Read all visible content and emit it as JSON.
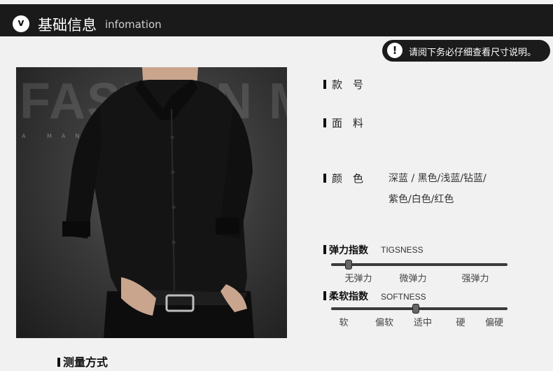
{
  "header": {
    "title": "基础信息",
    "subtitle": "infomation",
    "badge": "v"
  },
  "notice": {
    "icon": "exclamation-icon",
    "text": "请阅下务必仔细查看尺寸说明。"
  },
  "photo": {
    "watermark_big": "FASHION MAN",
    "watermark_small": "A MAN SHIRT"
  },
  "specs": {
    "style_label": "款　号",
    "fabric_label": "面　料",
    "color_label": "颜　色",
    "color_value_line1": "深蓝 / 黑色/浅蓝/钻蓝/",
    "color_value_line2": "紫色/白色/红色"
  },
  "elasticity": {
    "title": "弹力指数",
    "subtitle": "TIGSNESS",
    "level": 0.1,
    "ticks": [
      "无弹力",
      "微弹力",
      "强弹力"
    ]
  },
  "softness": {
    "title": "柔软指数",
    "subtitle": "SOFTNESS",
    "level": 0.48,
    "ticks": [
      "软",
      "偏软",
      "适中",
      "硬",
      "偏硬"
    ]
  },
  "bottom": {
    "title": "测量方式"
  }
}
